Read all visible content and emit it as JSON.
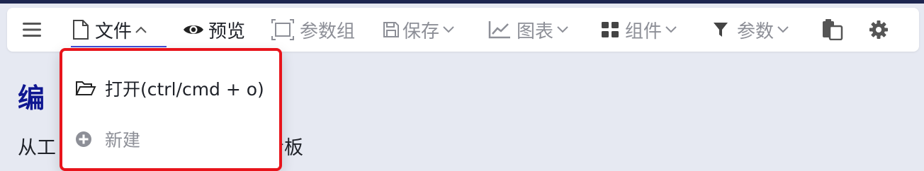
{
  "toolbar": {
    "menu_icon": "hamburger-icon",
    "items": [
      {
        "label": "文件",
        "icon": "file-icon",
        "chevron": "up"
      },
      {
        "label": "预览",
        "icon": "eye-icon"
      },
      {
        "label": "参数组",
        "icon": "frame-icon"
      },
      {
        "label": "保存",
        "icon": "save-icon",
        "chevron": "down"
      },
      {
        "label": "图表",
        "icon": "line-chart-icon",
        "chevron": "down"
      },
      {
        "label": "组件",
        "icon": "grid-icon",
        "chevron": "down"
      },
      {
        "label": "参数",
        "icon": "filter-icon",
        "chevron": "down"
      }
    ],
    "clipboard_icon": "clipboard-icon",
    "settings_icon": "gear-icon"
  },
  "file_menu": {
    "items": [
      {
        "label": "打开(ctrl/cmd + o)",
        "icon": "folder-open-icon"
      },
      {
        "label": "新建",
        "icon": "plus-circle-icon"
      }
    ]
  },
  "page": {
    "heading_visible": "编",
    "description_start": "从工",
    "description_end": "看板"
  },
  "colors": {
    "accent": "#3f4bd8",
    "highlight_border": "#e8141b",
    "heading": "#0f1791",
    "muted": "#8d8f97",
    "background": "#e6e9f2"
  }
}
